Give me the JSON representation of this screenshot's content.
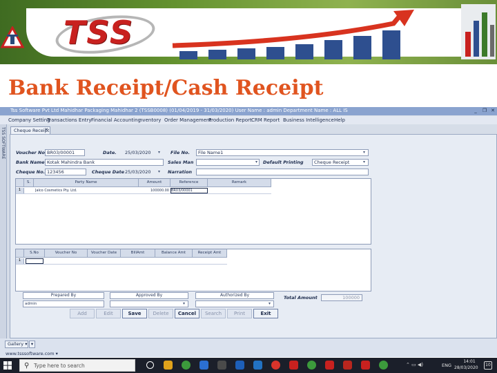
{
  "banner": {
    "logo_text": "TSS",
    "slide_title": "Bank Receipt/Cash Receipt"
  },
  "window": {
    "title": "Tss Software Pvt Ltd  Mahidhar Packaging  Mahidhar 2 (TSSB0008)  (01/04/2019 - 31/03/2020)  User Name : admin  Department Name : ALL IS",
    "min_label": "_",
    "max_label": "❐",
    "close_label": "✕"
  },
  "menu": [
    "Company Setting",
    "Transactions Entry",
    "Financial Accounting",
    "nventory",
    "Order Management",
    "Production Report",
    "CRM Report",
    "Business Intelligence",
    "Help"
  ],
  "vertical_tab": "TSS SOFTWARE",
  "document_tab": {
    "label": "Cheque Receipt",
    "close": "✕"
  },
  "form": {
    "voucher_no": {
      "label": "Voucher No.",
      "value": "BR03/00001"
    },
    "date": {
      "label": "Date.",
      "value": "25/03/2020"
    },
    "file_no": {
      "label": "File No.",
      "value": "File Name1"
    },
    "bank_name": {
      "label": "Bank Name",
      "value": "Kotak Mahindra Bank"
    },
    "sales_man": {
      "label": "Sales Man",
      "value": ""
    },
    "default_printing": {
      "label": "Default Printing",
      "value": "Cheque Receipt"
    },
    "cheque_no": {
      "label": "Cheque No.",
      "value": "123456"
    },
    "cheque_date": {
      "label": "Cheque Date",
      "value": "25/03/2020"
    },
    "narration": {
      "label": "Narration",
      "value": ""
    }
  },
  "party_grid": {
    "columns": [
      "",
      "S.",
      "Party Name",
      "Amount",
      "Reference",
      "Remark"
    ],
    "rows": [
      {
        "marker": "1",
        "party": "Jalco Cosmetics Pty. Ltd.",
        "amount": "100000.00",
        "reference": "BR03/00001"
      }
    ]
  },
  "bill_grid": {
    "columns": [
      "",
      "S.No",
      "Voucher No",
      "Voucher Date",
      "BillAmt",
      "Balance Amt",
      "Receipt Amt"
    ],
    "rows": [
      {
        "marker": "1"
      }
    ]
  },
  "signatures": {
    "prepared_by": {
      "label": "Prepared By",
      "value": "admin"
    },
    "approved_by": {
      "label": "Approved By",
      "value": ""
    },
    "authorized_by": {
      "label": "Authorized By",
      "value": ""
    }
  },
  "total": {
    "label": "Total Amount",
    "value": "100000"
  },
  "buttons": [
    {
      "label": "Add",
      "enabled": false
    },
    {
      "label": "Edit",
      "enabled": false
    },
    {
      "label": "Save",
      "enabled": true
    },
    {
      "label": "Delete",
      "enabled": false
    },
    {
      "label": "Cancel",
      "enabled": true
    },
    {
      "label": "Search",
      "enabled": false
    },
    {
      "label": "Print",
      "enabled": false
    },
    {
      "label": "Exit",
      "enabled": true
    }
  ],
  "status": {
    "gallery_label": "Gallery ▾",
    "gallery_extra": "▾",
    "url": "www.tsssoftware.com ▾"
  },
  "taskbar": {
    "search_placeholder": "Type here to search",
    "tray_icons": "⌃ ▭ ◀)",
    "language": "ENG",
    "time": "14:01",
    "date": "28/03/2020",
    "notification": "10"
  },
  "colors": {
    "title_orange": "#e0541f",
    "logo_red": "#c8211f",
    "banner_green": "#64922f",
    "app_blue": "#8aa3cf"
  }
}
